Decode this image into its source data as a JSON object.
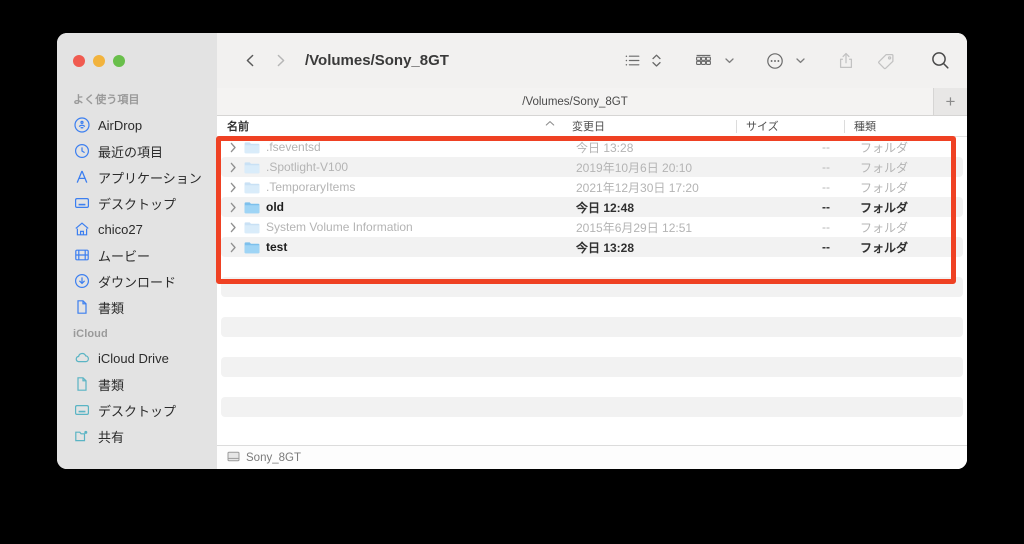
{
  "window": {
    "traffic_lights": [
      "close",
      "minimize",
      "zoom"
    ]
  },
  "toolbar": {
    "back_icon": "chevron-left",
    "forward_icon": "chevron-right",
    "path_title": "/Volumes/Sony_8GT",
    "view_list_icon": "list-view-icon",
    "sort_icon": "sort-updown-icon",
    "group_icon": "group-view-icon",
    "action_icon": "more-ellipsis-icon",
    "share_icon": "share-icon",
    "tag_icon": "tag-icon",
    "search_icon": "search-icon"
  },
  "tabbar": {
    "active_tab": "/Volumes/Sony_8GT",
    "add_tab_label": "+"
  },
  "columns": {
    "name": "名前",
    "date_modified": "変更日",
    "size": "サイズ",
    "kind": "種類",
    "sort_indicator": "^"
  },
  "files": [
    {
      "name": ".fseventsd",
      "date": "今日 13:28",
      "size": "--",
      "kind": "フォルダ",
      "dimmed": true
    },
    {
      "name": ".Spotlight-V100",
      "date": "2019年10月6日 20:10",
      "size": "--",
      "kind": "フォルダ",
      "dimmed": true
    },
    {
      "name": ".TemporaryItems",
      "date": "2021年12月30日 17:20",
      "size": "--",
      "kind": "フォルダ",
      "dimmed": true
    },
    {
      "name": "old",
      "date": "今日 12:48",
      "size": "--",
      "kind": "フォルダ",
      "dimmed": false
    },
    {
      "name": "System Volume Information",
      "date": "2015年6月29日 12:51",
      "size": "--",
      "kind": "フォルダ",
      "dimmed": true
    },
    {
      "name": "test",
      "date": "今日 13:28",
      "size": "--",
      "kind": "フォルダ",
      "dimmed": false
    }
  ],
  "empty_rows": 8,
  "statusbar": {
    "volume_icon": "drive-icon",
    "volume_name": "Sony_8GT"
  },
  "sidebar": {
    "sections": [
      {
        "title": "よく使う項目",
        "items": [
          {
            "label": "AirDrop",
            "icon": "airdrop-icon",
            "color": "#3c7ff0"
          },
          {
            "label": "最近の項目",
            "icon": "clock-icon",
            "color": "#3c7ff0"
          },
          {
            "label": "アプリケーション",
            "icon": "applications-icon",
            "color": "#3c7ff0"
          },
          {
            "label": "デスクトップ",
            "icon": "desktop-icon",
            "color": "#3c7ff0"
          },
          {
            "label": "chico27",
            "icon": "home-icon",
            "color": "#3c7ff0"
          },
          {
            "label": "ムービー",
            "icon": "movie-icon",
            "color": "#3c7ff0"
          },
          {
            "label": "ダウンロード",
            "icon": "download-icon",
            "color": "#3c7ff0"
          },
          {
            "label": "書類",
            "icon": "document-icon",
            "color": "#3c7ff0"
          }
        ]
      },
      {
        "title": "iCloud",
        "items": [
          {
            "label": "iCloud Drive",
            "icon": "cloud-icon",
            "color": "#5ab4c4"
          },
          {
            "label": "書類",
            "icon": "document-icon",
            "color": "#5ab4c4"
          },
          {
            "label": "デスクトップ",
            "icon": "desktop-icon",
            "color": "#5ab4c4"
          },
          {
            "label": "共有",
            "icon": "shared-folder-icon",
            "color": "#5ab4c4"
          }
        ]
      }
    ]
  },
  "annotation": {
    "highlight_color": "#ef4123",
    "shape": "rectangle"
  }
}
